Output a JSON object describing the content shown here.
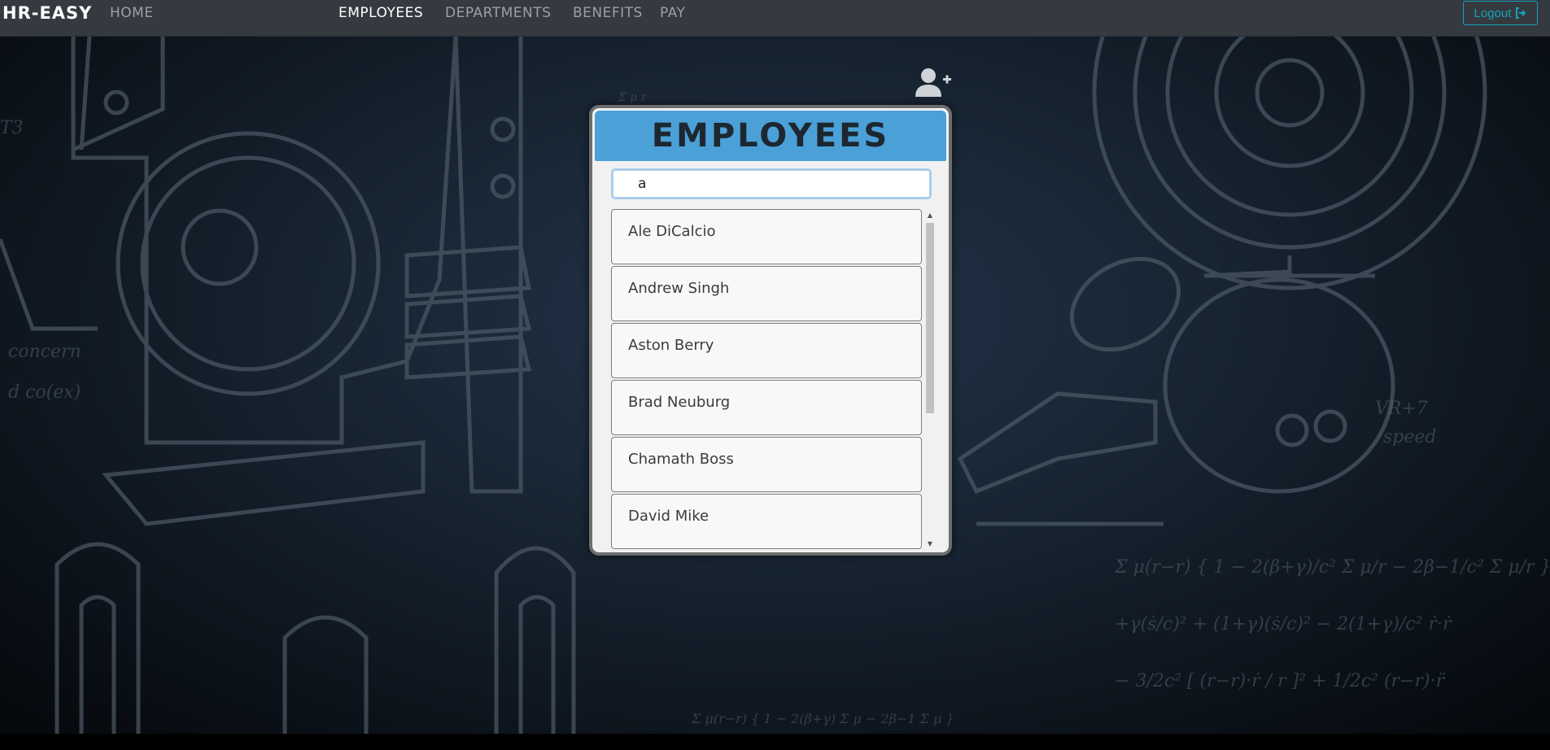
{
  "navbar": {
    "brand": "HR-EASY",
    "home": "HOME",
    "employees": "EMPLOYEES",
    "departments": "DEPARTMENTS",
    "benefits": "BENEFITS",
    "pay": "PAY",
    "logout": "Logout",
    "logout_icon": "sign-out-icon"
  },
  "panel": {
    "title": "EMPLOYEES",
    "search_value": "a",
    "employees": [
      {
        "name": "Ale DiCalcio"
      },
      {
        "name": "Andrew Singh"
      },
      {
        "name": "Aston Berry"
      },
      {
        "name": "Brad Neuburg"
      },
      {
        "name": "Chamath Boss"
      },
      {
        "name": "David Mike"
      }
    ]
  },
  "icons": {
    "add_user": "user-plus-icon"
  },
  "colors": {
    "navbar": "#343a40",
    "header": "#4ba0d8",
    "logout": "#17a2b8"
  }
}
